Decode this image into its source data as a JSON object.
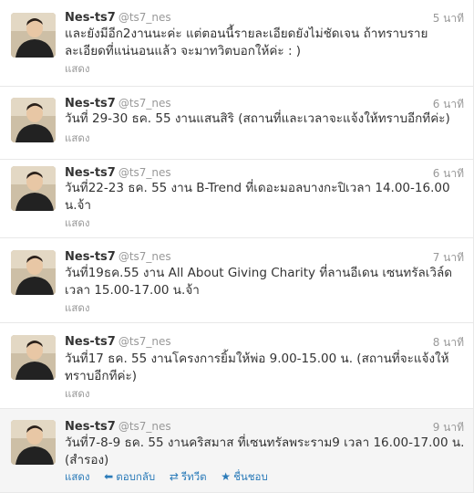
{
  "tweets": [
    {
      "name": "Nes-ts7",
      "handle": "@ts7_nes",
      "time": "5 นาที",
      "text": "และยังมีอีก2งานนะค่ะ แต่ตอนนี้รายละเอียดยังไม่ชัดเจน ถ้าทราบรายละเอียดที่แน่นอนแล้ว จะมาทวิตบอกให้ค่ะ : )",
      "expand": "แสดง"
    },
    {
      "name": "Nes-ts7",
      "handle": "@ts7_nes",
      "time": "6 นาที",
      "text": "วันที่ 29-30 ธค. 55 งานแสนสิริ (สถานที่และเวลาจะแจ้งให้ทราบอีกทีค่ะ)",
      "expand": "แสดง"
    },
    {
      "name": "Nes-ts7",
      "handle": "@ts7_nes",
      "time": "6 นาที",
      "text": "วันที่22-23 ธค. 55 งาน B-Trend ที่เดอะมอลบางกะปิเวลา 14.00-16.00 น.จ้า",
      "expand": "แสดง"
    },
    {
      "name": "Nes-ts7",
      "handle": "@ts7_nes",
      "time": "7 นาที",
      "text": "วันที่19ธค.55 งาน All About Giving Charity ที่ลานอีเดน เซนทรัลเวิล์ดเวลา 15.00-17.00 น.จ้า",
      "expand": "แสดง"
    },
    {
      "name": "Nes-ts7",
      "handle": "@ts7_nes",
      "time": "8 นาที",
      "text": "วันที่17 ธค. 55 งานโครงการยิ้มให้พ่อ 9.00-15.00 น. (สถานที่จะแจ้งให้ทราบอีกทีค่ะ)",
      "expand": "แสดง"
    },
    {
      "name": "Nes-ts7",
      "handle": "@ts7_nes",
      "time": "9 นาที",
      "text": "วันที่7-8-9 ธค. 55 งานคริสมาส ที่เซนทรัลพระราม9 เวลา 16.00-17.00 น.(สำรอง)",
      "expand": "แสดง",
      "actions": {
        "reply": "ตอบกลับ",
        "retweet": "รีทวีต",
        "favorite": "ชื่นชอบ"
      }
    }
  ],
  "icons": {
    "reply": "reply-icon",
    "retweet": "retweet-icon",
    "favorite": "star-icon"
  },
  "colors": {
    "link": "#2b7bb9",
    "muted": "#999999",
    "hover_bg": "#f5f5f5"
  }
}
